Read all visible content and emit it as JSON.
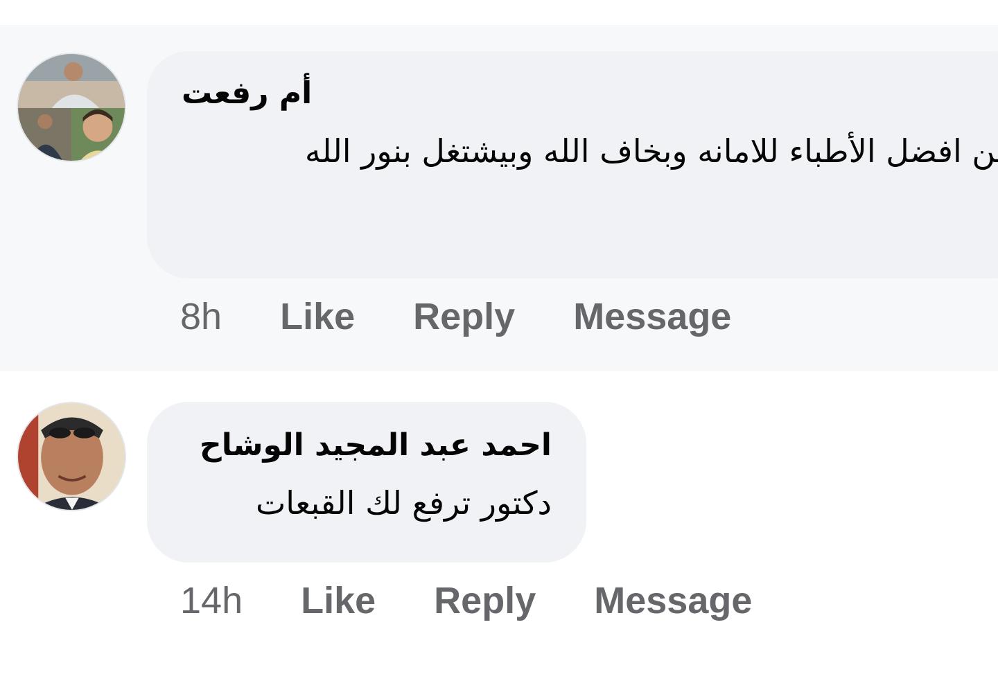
{
  "comments": [
    {
      "author": "أم رفعت",
      "text": "من افضل الأطباء للامانه وبخاف الله وبيشتغل بنور الله",
      "time": "8h",
      "like_label": "Like",
      "reply_label": "Reply",
      "message_label": "Message"
    },
    {
      "author": "احمد عبد المجيد الوشاح",
      "text": "دكتور ترفع لك القبعات",
      "time": "14h",
      "like_label": "Like",
      "reply_label": "Reply",
      "message_label": "Message"
    }
  ],
  "colors": {
    "bubble_bg": "#f0f2f5",
    "highlight_bg": "#f7f8fa",
    "meta_text": "#65676b",
    "primary_text": "#050505"
  }
}
